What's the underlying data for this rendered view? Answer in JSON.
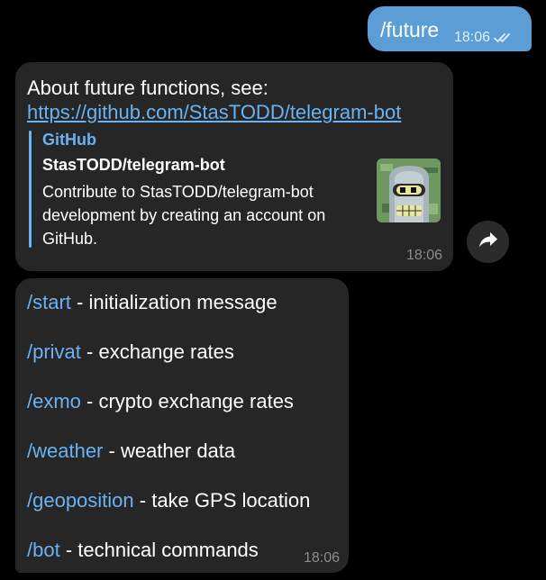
{
  "outgoing": {
    "text": "/future",
    "time": "18:06",
    "status_icon": "double-check-icon"
  },
  "message1": {
    "text": "About future functions, see:",
    "link": "https://github.com/StasTODD/telegram-bot",
    "preview": {
      "site": "GitHub",
      "title": "StasTODD/telegram-bot",
      "description": "Contribute to StasTODD/telegram-bot development by creating an account on GitHub.",
      "thumbnail": "bender-avatar-icon"
    },
    "time": "18:06"
  },
  "share_icon": "share-arrow-icon",
  "message2": {
    "commands": [
      {
        "cmd": "/start",
        "desc": " - initialization message"
      },
      {
        "cmd": "/privat",
        "desc": " - exchange rates"
      },
      {
        "cmd": "/exmo",
        "desc": " - crypto exchange rates"
      },
      {
        "cmd": "/weather",
        "desc": " - weather data"
      },
      {
        "cmd": "/geoposition",
        "desc": " - take GPS location"
      },
      {
        "cmd": "/bot",
        "desc": " - technical commands"
      }
    ],
    "time": "18:06"
  },
  "colors": {
    "background": "#000000",
    "bubble_in": "#262626",
    "bubble_out": "#5b9ed6",
    "link": "#6ab2f2",
    "meta": "#8c8c8c"
  }
}
